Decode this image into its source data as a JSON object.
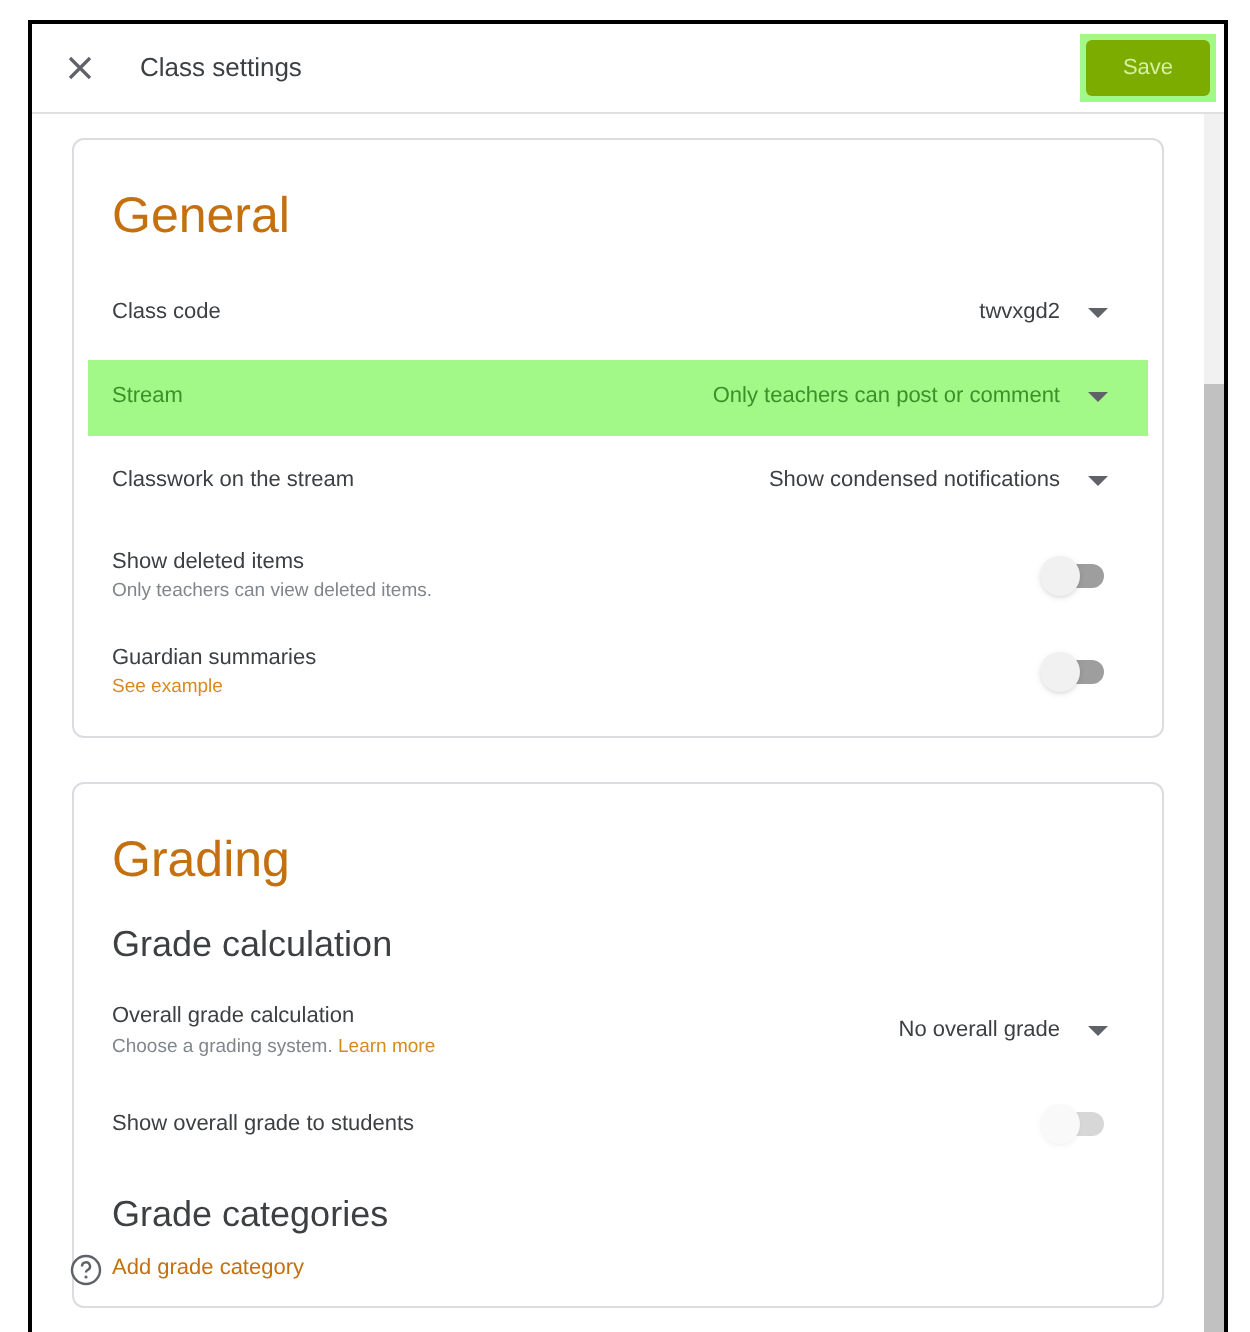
{
  "header": {
    "title": "Class settings",
    "save_label": "Save"
  },
  "general": {
    "title": "General",
    "rows": [
      {
        "kind": "select",
        "label": "Class code",
        "value": "twvxgd2",
        "highlighted": false
      },
      {
        "kind": "select",
        "label": "Stream",
        "value": "Only teachers can post or comment",
        "highlighted": true
      },
      {
        "kind": "select",
        "label": "Classwork on the stream",
        "value": "Show condensed notifications",
        "highlighted": false
      },
      {
        "kind": "toggle",
        "label": "Show deleted items",
        "hint": "Only teachers can view deleted items.",
        "on": false,
        "disabled": false
      },
      {
        "kind": "toggle",
        "label": "Guardian summaries",
        "link": "See example",
        "on": false,
        "disabled": false
      }
    ]
  },
  "grading": {
    "title": "Grading",
    "calc_heading": "Grade calculation",
    "rows": [
      {
        "kind": "select",
        "label": "Overall grade calculation",
        "hint": "Choose a grading system.",
        "link": "Learn more",
        "value": "No overall grade",
        "highlighted": false
      },
      {
        "kind": "toggle",
        "label": "Show overall grade to students",
        "on": false,
        "disabled": true
      }
    ],
    "categories_heading": "Grade categories",
    "add_link": "Add grade category"
  }
}
